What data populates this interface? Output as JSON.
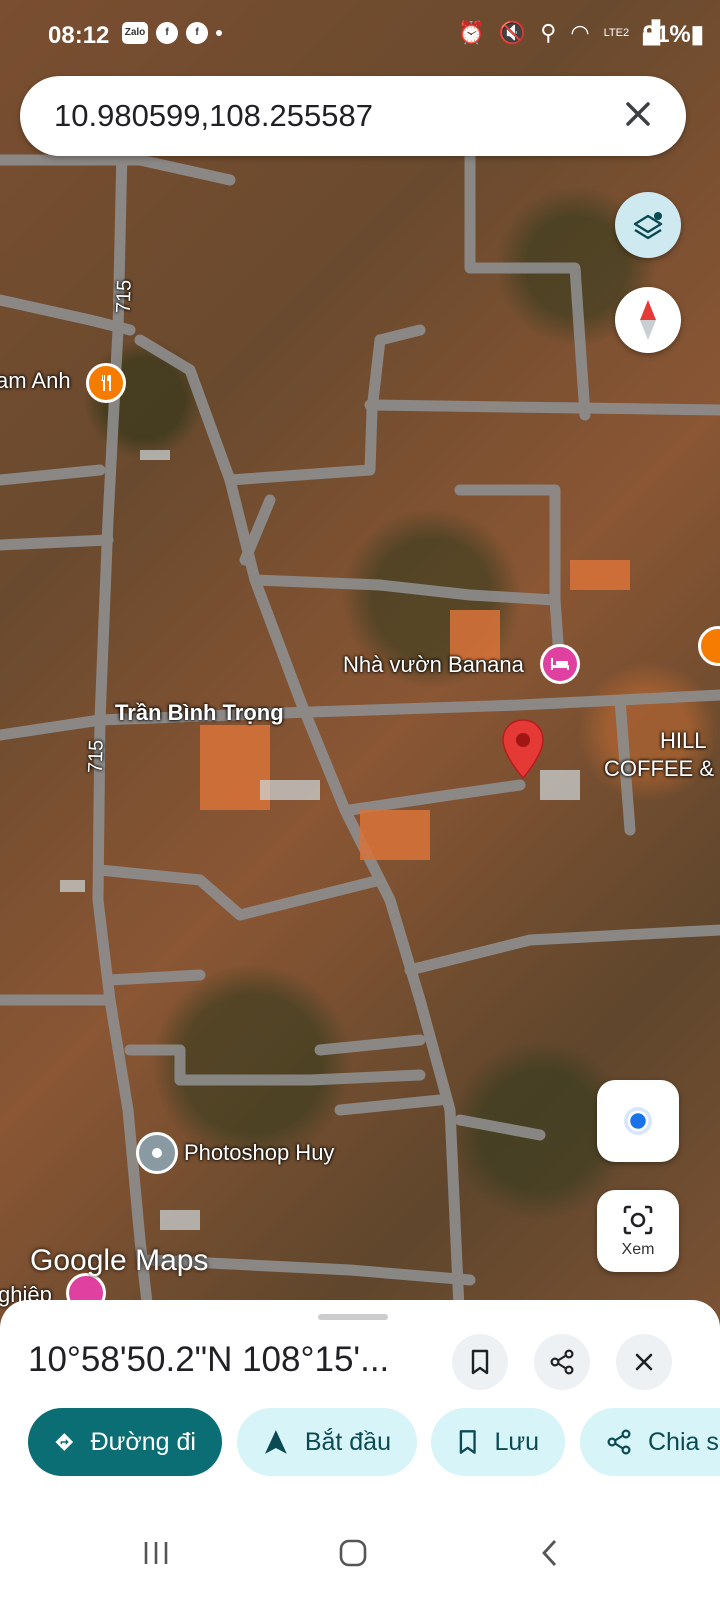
{
  "status_bar": {
    "time": "08:12",
    "battery": "91%",
    "app_icons": [
      "Zalo",
      "facebook-icon",
      "facebook-icon"
    ],
    "network": "LTE2"
  },
  "search": {
    "query": "10.980599,108.255587"
  },
  "map": {
    "labels": {
      "road_715_top": "715",
      "road_715_bottom": "715",
      "street": "Trần Bình Trọng",
      "poi_left": "am Anh",
      "poi_banana": "Nhà vườn Banana",
      "poi_hill_1": "HILL",
      "poi_hill_2": "COFFEE &",
      "poi_photoshop": "Photoshop Huy",
      "poi_bottom": "ghiệp"
    },
    "watermark": "Google Maps",
    "xem_label": "Xem"
  },
  "sheet": {
    "coordinates": "10°58'50.2\"N 108°15'...",
    "chips": {
      "directions": "Đường đi",
      "start": "Bắt đầu",
      "save": "Lưu",
      "share": "Chia s"
    }
  },
  "colors": {
    "accent": "#0b6e74",
    "chip": "#d7f4f8",
    "pin": "#e53935",
    "hotel": "#e040a0",
    "food": "#f57c00"
  }
}
